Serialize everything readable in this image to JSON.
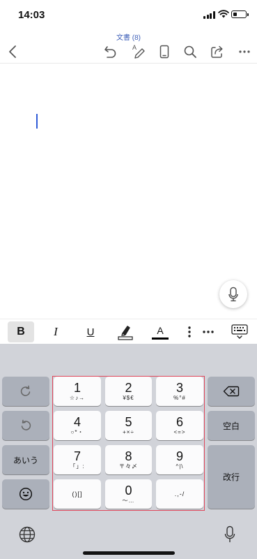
{
  "status_bar": {
    "time": "14:03",
    "battery_level": 0.35
  },
  "document": {
    "title": "文書 (8)"
  },
  "toolbar": {
    "icons": [
      "back-icon",
      "undo-icon",
      "draw-icon",
      "phone-view-icon",
      "search-icon",
      "share-icon",
      "more-icon"
    ]
  },
  "format_bar": {
    "bold": "B",
    "italic": "I",
    "underline": "U",
    "font_color": "A",
    "font_color_hex": "#000000"
  },
  "keyboard": {
    "keys": [
      {
        "num": "1",
        "sub": "☆♪→"
      },
      {
        "num": "2",
        "sub": "¥$€"
      },
      {
        "num": "3",
        "sub": "%°#"
      },
      {
        "num": "4",
        "sub": "○*・"
      },
      {
        "num": "5",
        "sub": "+×÷"
      },
      {
        "num": "6",
        "sub": "<=>"
      },
      {
        "num": "7",
        "sub": "「」:"
      },
      {
        "num": "8",
        "sub": "〒々〆"
      },
      {
        "num": "9",
        "sub": "^|\\"
      },
      {
        "num": "0",
        "sub": "〜…"
      }
    ],
    "brackets_key": "()[]",
    "punct_key": ".,-/",
    "mode_key": "あいう",
    "space_key": "空白",
    "return_key": "改行",
    "highlight_color": "#e0465a"
  }
}
